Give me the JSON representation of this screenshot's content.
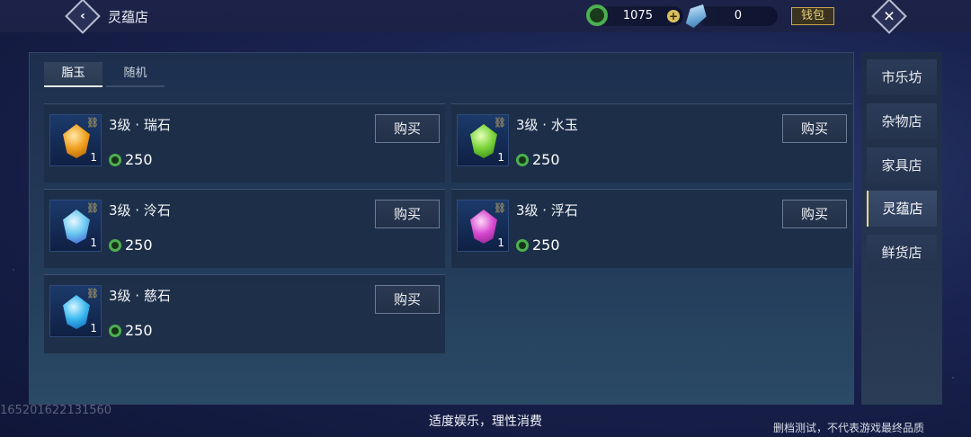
{
  "header": {
    "back_icon": "back-chevron-icon",
    "title": "灵蕴店",
    "jade_amount": "1075",
    "jade_icon": "jade-coin-icon",
    "crystal_amount": "0",
    "crystal_icon": "crystal-icon",
    "wallet_label": "钱包",
    "close_icon": "close-icon"
  },
  "tabs": [
    {
      "label": "脂玉",
      "active": true
    },
    {
      "label": "随机",
      "active": false
    }
  ],
  "items": [
    {
      "name": "3级 · 瑞石",
      "price": "250",
      "qty": "1",
      "buy_label": "购买",
      "gem_color": "#f0a020"
    },
    {
      "name": "3级 · 水玉",
      "price": "250",
      "qty": "1",
      "buy_label": "购买",
      "gem_color": "#7ad43a"
    },
    {
      "name": "3级 · 泠石",
      "price": "250",
      "qty": "1",
      "buy_label": "购买",
      "gem_color": "#6ac8f0"
    },
    {
      "name": "3级 · 浮石",
      "price": "250",
      "qty": "1",
      "buy_label": "购买",
      "gem_color": "#d84ad0"
    },
    {
      "name": "3级 · 慈石",
      "price": "250",
      "qty": "1",
      "buy_label": "购买",
      "gem_color": "#3ab8f0"
    }
  ],
  "sidenav": [
    {
      "label": "市乐坊",
      "active": false
    },
    {
      "label": "杂物店",
      "active": false
    },
    {
      "label": "家具店",
      "active": false
    },
    {
      "label": "灵蕴店",
      "active": true
    },
    {
      "label": "鲜货店",
      "active": false
    }
  ],
  "footer": {
    "slogan": "适度娱乐，理性消费",
    "watermark": "165201622131560",
    "disclaimer": "删档测试，不代表游戏最终品质"
  }
}
